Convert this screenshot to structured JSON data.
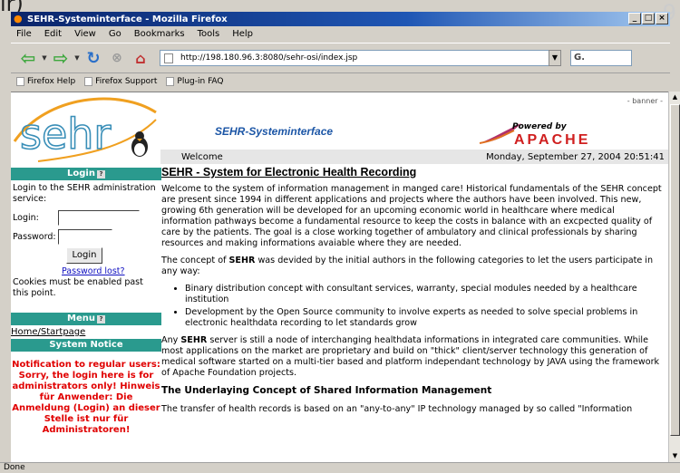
{
  "window": {
    "title": "SEHR-Systeminterface - Mozilla Firefox"
  },
  "menu": {
    "items": [
      "File",
      "Edit",
      "View",
      "Go",
      "Bookmarks",
      "Tools",
      "Help"
    ]
  },
  "nav": {
    "url": "http://198.180.96.3:8080/sehr-osi/index.jsp",
    "search_value": "G."
  },
  "bookmarks": [
    "Firefox Help",
    "Firefox Support",
    "Plug-in FAQ"
  ],
  "page": {
    "site_name": "SEHR-Systeminterface",
    "banner_label": "- banner -",
    "powered_by": "Powered by",
    "apache": "APACHE",
    "welcome": "Welcome",
    "datetime": "Monday, September 27, 2004 20:51:41",
    "sidebar": {
      "login_header": "Login",
      "login_intro": "Login to the SEHR administration service:",
      "login_label": "Login:",
      "password_label": "Password:",
      "login_button": "Login",
      "password_lost": "Password lost?",
      "cookies_note": "Cookies must be enabled past this point.",
      "menu_header": "Menu",
      "home_link": "Home/Startpage",
      "notice_header": "System Notice",
      "notice_text": "Notification to regular users: Sorry, the login here is for administrators only! Hinweis für Anwender: Die Anmeldung (Login) an dieser Stelle ist nur für Administratoren!"
    },
    "main": {
      "heading": "SEHR - System for Electronic Health Recording",
      "para1": "Welcome to the system of information management in manged care! Historical fundamentals of the SEHR concept are present since 1994 in different applications and projects where the authors have been involved. This new, growing 6th generation will be developed for an upcoming economic world in healthcare where medical information pathways become a fundamental resource to keep the costs in balance with an excpected quality of care by the patients. The goal is a close working together of ambulatory and clinical professionals by sharing resources and making informations avaiable where they are needed.",
      "para2_pre": "The concept of ",
      "para2_bold": "SEHR",
      "para2_post": " was devided by the initial authors in the following categories to let the users participate in any way:",
      "bullets": [
        "Binary distribution concept with consultant services, warranty, special modules needed by a healthcare institution",
        "Development by the Open Source community to involve experts as needed to solve special problems in electronic healthdata recording to let standards grow"
      ],
      "para3_pre": "Any ",
      "para3_bold": "SEHR",
      "para3_post": " server is still a node of interchanging healthdata informations in integrated care communities. While most applications on the market are proprietary and build on \"thick\" client/server technology this generation of medical software started on a multi-tier based and platform independant technology by JAVA using the framework of Apache Foundation projects.",
      "subheading": "The Underlaying Concept of Shared Information Management",
      "para4": "The transfer of health records is based on an \"any-to-any\" IP technology managed by so called \"Information"
    }
  },
  "status": {
    "text": "Done"
  },
  "colors": {
    "sidebar_header": "#2a9a8e",
    "notice": "#e00000",
    "site_name": "#1c56a6",
    "apache": "#d02020"
  }
}
